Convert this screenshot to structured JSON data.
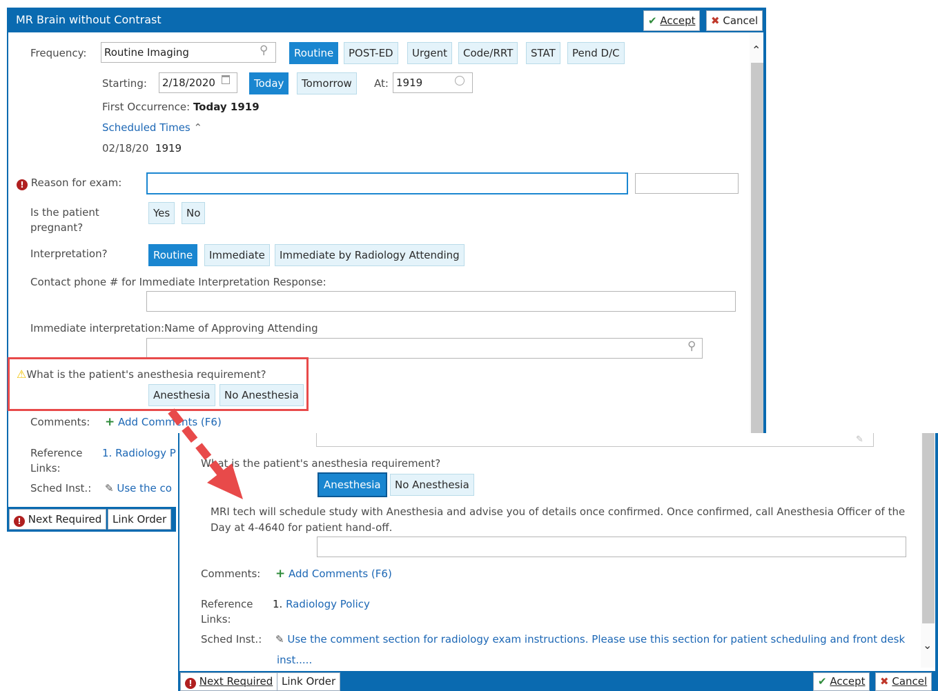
{
  "back": {
    "title": "MR Brain without Contrast",
    "accept": "Accept",
    "cancel": "Cancel",
    "frequency_label": "Frequency:",
    "frequency_value": "Routine Imaging",
    "freq_buttons": [
      "Routine",
      "POST-ED",
      "Urgent",
      "Code/RRT",
      "STAT",
      "Pend D/C"
    ],
    "starting_label": "Starting:",
    "starting_value": "2/18/2020",
    "today": "Today",
    "tomorrow": "Tomorrow",
    "at_label": "At:",
    "at_value": "1919",
    "first_occ_label": "First Occurrence:",
    "first_occ_value": "Today 1919",
    "scheduled_times": "Scheduled Times",
    "sched_date": "02/18/20",
    "sched_time": "1919",
    "reason_label": "Reason for exam:",
    "pregnant_label_1": "Is the patient",
    "pregnant_label_2": "pregnant?",
    "yes": "Yes",
    "no": "No",
    "interp_label": "Interpretation?",
    "interp_buttons": [
      "Routine",
      "Immediate",
      "Immediate by Radiology Attending"
    ],
    "contact_label": "Contact phone # for Immediate Interpretation Response:",
    "approving_label": "Immediate interpretation:Name of Approving Attending",
    "anesthesia_question": "What is the patient's anesthesia requirement?",
    "anesthesia": "Anesthesia",
    "no_anesthesia": "No Anesthesia",
    "comments_label": "Comments:",
    "add_comments": "Add Comments (F6)",
    "reference_label_1": "Reference",
    "reference_label_2": "Links:",
    "ref_link": "1. Radiology P",
    "sched_inst_label": "Sched Inst.:",
    "sched_inst_link": "Use the co",
    "next_required": "Next Required",
    "link_order": "Link Order"
  },
  "front": {
    "anesthesia_question": "What is the patient's anesthesia requirement?",
    "anesthesia": "Anesthesia",
    "no_anesthesia": "No Anesthesia",
    "info_line_1": "MRI tech will schedule study with Anesthesia and advise you of details once confirmed. Once confirmed, call Anesthesia Officer of the",
    "info_line_2": "Day at 4-4640 for patient hand-off.",
    "comments_label": "Comments:",
    "add_comments": "Add Comments (F6)",
    "reference_label_1": "Reference",
    "reference_label_2": "Links:",
    "ref_link_num": "1.",
    "ref_link": "Radiology Policy",
    "sched_inst_label": "Sched Inst.:",
    "sched_inst_line_1": "Use the comment section for radiology exam instructions.  Please use this section for patient scheduling and front desk",
    "sched_inst_line_2": "inst.....",
    "next_required": "Next Required",
    "link_order": "Link Order",
    "accept": "Accept",
    "cancel": "Cancel"
  },
  "colors": {
    "title_bar": "#0a6ab0",
    "selected_button": "#1a86d0",
    "button_bg": "#e4f3fa",
    "link": "#1c67b5",
    "highlight_box": "#e84a4a",
    "arrow": "#e84a4a",
    "error_icon": "#b01f1f",
    "warning_icon": "#f2c200"
  },
  "icons": [
    "checkmark-icon",
    "x-icon",
    "search-icon",
    "calendar-icon",
    "clock-icon",
    "chevron-up-icon",
    "double-chevron-up-icon",
    "error-icon",
    "warning-icon",
    "plus-icon",
    "pencil-icon",
    "chevron-down-icon",
    "arrow-annotation"
  ]
}
